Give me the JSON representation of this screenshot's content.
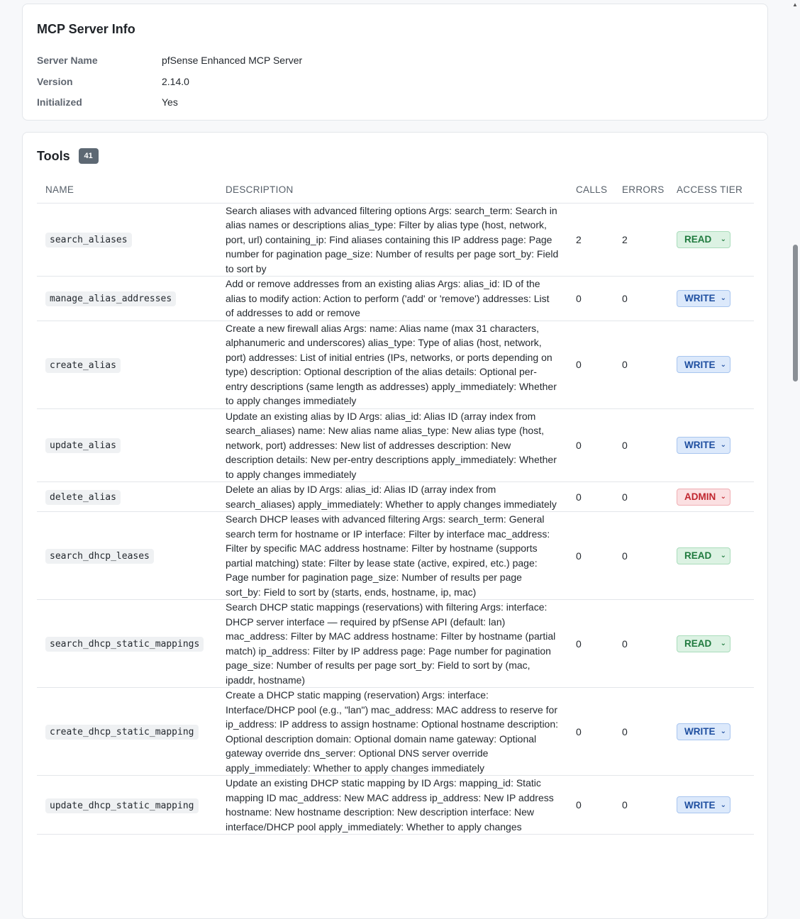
{
  "server_info": {
    "title": "MCP Server Info",
    "rows": [
      {
        "label": "Server Name",
        "value": "pfSense Enhanced MCP Server"
      },
      {
        "label": "Version",
        "value": "2.14.0"
      },
      {
        "label": "Initialized",
        "value": "Yes"
      }
    ]
  },
  "tools": {
    "title": "Tools",
    "count": "41",
    "columns": {
      "name": "NAME",
      "description": "DESCRIPTION",
      "calls": "CALLS",
      "errors": "ERRORS",
      "tier": "ACCESS TIER"
    },
    "rows": [
      {
        "name": "search_aliases",
        "description": "Search aliases with advanced filtering options Args: search_term: Search in alias names or descriptions alias_type: Filter by alias type (host, network, port, url) containing_ip: Find aliases containing this IP address page: Page number for pagination page_size: Number of results per page sort_by: Field to sort by",
        "calls": "2",
        "errors": "2",
        "tier": "READ"
      },
      {
        "name": "manage_alias_addresses",
        "description": "Add or remove addresses from an existing alias Args: alias_id: ID of the alias to modify action: Action to perform ('add' or 'remove') addresses: List of addresses to add or remove",
        "calls": "0",
        "errors": "0",
        "tier": "WRITE"
      },
      {
        "name": "create_alias",
        "description": "Create a new firewall alias Args: name: Alias name (max 31 characters, alphanumeric and underscores) alias_type: Type of alias (host, network, port) addresses: List of initial entries (IPs, networks, or ports depending on type) description: Optional description of the alias details: Optional per-entry descriptions (same length as addresses) apply_immediately: Whether to apply changes immediately",
        "calls": "0",
        "errors": "0",
        "tier": "WRITE"
      },
      {
        "name": "update_alias",
        "description": "Update an existing alias by ID Args: alias_id: Alias ID (array index from search_aliases) name: New alias name alias_type: New alias type (host, network, port) addresses: New list of addresses description: New description details: New per-entry descriptions apply_immediately: Whether to apply changes immediately",
        "calls": "0",
        "errors": "0",
        "tier": "WRITE"
      },
      {
        "name": "delete_alias",
        "description": "Delete an alias by ID Args: alias_id: Alias ID (array index from search_aliases) apply_immediately: Whether to apply changes immediately",
        "calls": "0",
        "errors": "0",
        "tier": "ADMIN"
      },
      {
        "name": "search_dhcp_leases",
        "description": "Search DHCP leases with advanced filtering Args: search_term: General search term for hostname or IP interface: Filter by interface mac_address: Filter by specific MAC address hostname: Filter by hostname (supports partial matching) state: Filter by lease state (active, expired, etc.) page: Page number for pagination page_size: Number of results per page sort_by: Field to sort by (starts, ends, hostname, ip, mac)",
        "calls": "0",
        "errors": "0",
        "tier": "READ"
      },
      {
        "name": "search_dhcp_static_mappings",
        "description": "Search DHCP static mappings (reservations) with filtering Args: interface: DHCP server interface — required by pfSense API (default: lan) mac_address: Filter by MAC address hostname: Filter by hostname (partial match) ip_address: Filter by IP address page: Page number for pagination page_size: Number of results per page sort_by: Field to sort by (mac, ipaddr, hostname)",
        "calls": "0",
        "errors": "0",
        "tier": "READ"
      },
      {
        "name": "create_dhcp_static_mapping",
        "description": "Create a DHCP static mapping (reservation) Args: interface: Interface/DHCP pool (e.g., \"lan\") mac_address: MAC address to reserve for ip_address: IP address to assign hostname: Optional hostname description: Optional description domain: Optional domain name gateway: Optional gateway override dns_server: Optional DNS server override apply_immediately: Whether to apply changes immediately",
        "calls": "0",
        "errors": "0",
        "tier": "WRITE"
      },
      {
        "name": "update_dhcp_static_mapping",
        "description": "Update an existing DHCP static mapping by ID Args: mapping_id: Static mapping ID mac_address: New MAC address ip_address: New IP address hostname: New hostname description: New description interface: New interface/DHCP pool apply_immediately: Whether to apply changes",
        "calls": "0",
        "errors": "0",
        "tier": "WRITE"
      }
    ]
  },
  "colors": {
    "read": "#1f7a3e",
    "write": "#1f4fa0",
    "admin": "#c0262f",
    "badge": "#5d6873"
  },
  "icons": {
    "tier_dropdown": "chevron-down-icon",
    "scroll_up": "triangle-up-icon"
  }
}
